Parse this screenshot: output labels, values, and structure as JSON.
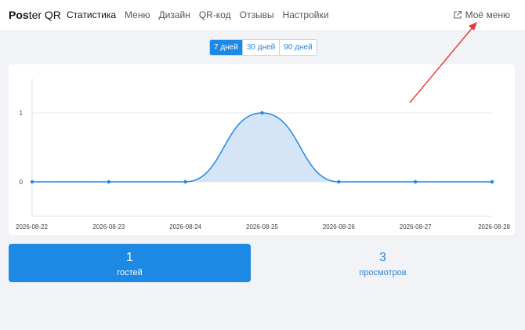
{
  "brand": {
    "bold": "Pos",
    "rest": "ter QR"
  },
  "nav": {
    "items": [
      {
        "label": "Статистика",
        "active": true
      },
      {
        "label": "Меню",
        "active": false
      },
      {
        "label": "Дизайн",
        "active": false
      },
      {
        "label": "QR-код",
        "active": false
      },
      {
        "label": "Отзывы",
        "active": false
      },
      {
        "label": "Настройки",
        "active": false
      }
    ],
    "my_menu": {
      "label": "Моё меню",
      "icon": "external-link-icon"
    }
  },
  "periods": [
    {
      "label": "7 дней",
      "active": true
    },
    {
      "label": "30 дней",
      "active": false
    },
    {
      "label": "90 дней",
      "active": false
    }
  ],
  "chart_data": {
    "type": "area",
    "x": [
      "2026-08-22",
      "2026-08-23",
      "2026-08-24",
      "2026-08-25",
      "2026-08-26",
      "2026-08-27",
      "2026-08-28"
    ],
    "series": [
      {
        "values": [
          0,
          0,
          0,
          1,
          0,
          0,
          0
        ]
      }
    ],
    "yticks": [
      "0",
      "1"
    ],
    "ylim": [
      -0.5,
      1.5
    ],
    "grid": true,
    "colors": {
      "line": "#1e88e5",
      "fill": "#d5e5f7"
    }
  },
  "stats": [
    {
      "value": "1",
      "label": "гостей",
      "color": "#1e88e5"
    },
    {
      "value": "3",
      "label": "просмотров"
    }
  ],
  "annotation": {
    "type": "arrow",
    "color": "#e53935"
  }
}
